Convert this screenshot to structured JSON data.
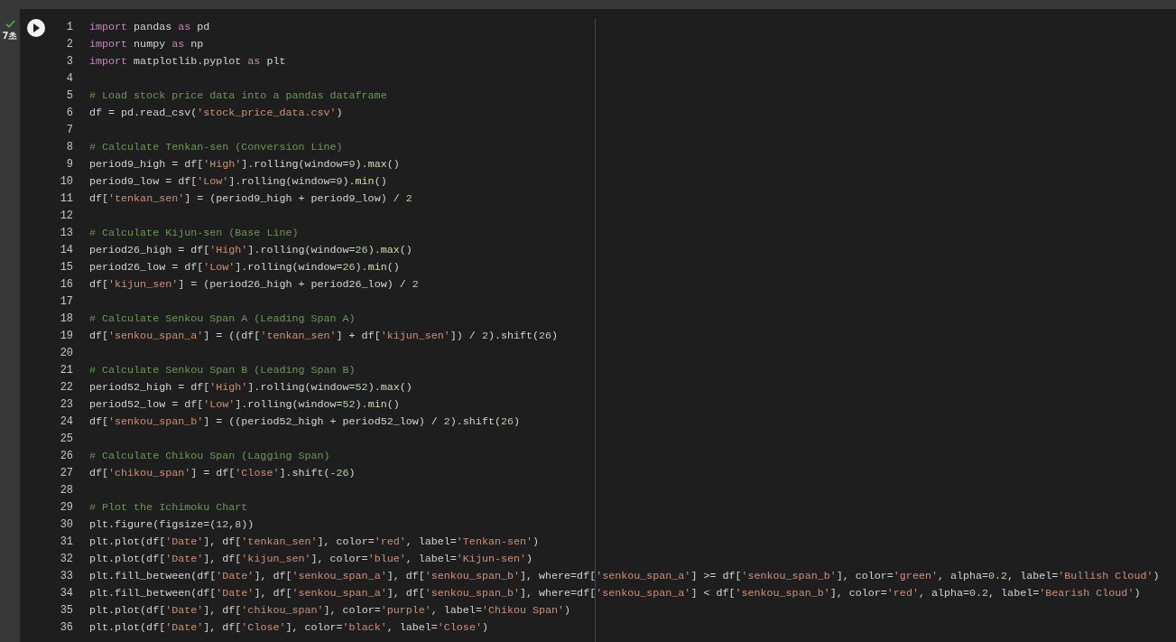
{
  "cell": {
    "status": {
      "done": true,
      "duration": "7초"
    },
    "lines": [
      {
        "number": "1",
        "tokens": [
          {
            "kind": "kw",
            "text": "import"
          },
          {
            "kind": "tx",
            "text": " pandas "
          },
          {
            "kind": "kw",
            "text": "as"
          },
          {
            "kind": "tx",
            "text": " pd"
          }
        ]
      },
      {
        "number": "2",
        "tokens": [
          {
            "kind": "kw",
            "text": "import"
          },
          {
            "kind": "tx",
            "text": " numpy "
          },
          {
            "kind": "kw",
            "text": "as"
          },
          {
            "kind": "tx",
            "text": " np"
          }
        ]
      },
      {
        "number": "3",
        "tokens": [
          {
            "kind": "kw",
            "text": "import"
          },
          {
            "kind": "tx",
            "text": " matplotlib.pyplot "
          },
          {
            "kind": "kw",
            "text": "as"
          },
          {
            "kind": "tx",
            "text": " plt"
          }
        ]
      },
      {
        "number": "4"
      },
      {
        "number": "5",
        "tokens": [
          {
            "kind": "cm",
            "text": "# Load stock price data into a pandas dataframe"
          }
        ]
      },
      {
        "number": "6",
        "tokens": [
          {
            "kind": "tx",
            "text": "df = pd.read_csv("
          },
          {
            "kind": "st",
            "text": "'stock_price_data.csv'"
          },
          {
            "kind": "tx",
            "text": ")"
          }
        ]
      },
      {
        "number": "7"
      },
      {
        "number": "8",
        "tokens": [
          {
            "kind": "cm",
            "text": "# Calculate Tenkan-sen (Conversion Line)"
          }
        ]
      },
      {
        "number": "9",
        "tokens": [
          {
            "kind": "tx",
            "text": "period9_high = df["
          },
          {
            "kind": "st",
            "text": "'High'"
          },
          {
            "kind": "tx",
            "text": "].rolling(window="
          },
          {
            "kind": "nu",
            "text": "9"
          },
          {
            "kind": "tx",
            "text": ")."
          },
          {
            "kind": "fn",
            "text": "max"
          },
          {
            "kind": "tx",
            "text": "()"
          }
        ]
      },
      {
        "number": "10",
        "tokens": [
          {
            "kind": "tx",
            "text": "period9_low = df["
          },
          {
            "kind": "st",
            "text": "'Low'"
          },
          {
            "kind": "tx",
            "text": "].rolling(window="
          },
          {
            "kind": "nu",
            "text": "9"
          },
          {
            "kind": "tx",
            "text": ")."
          },
          {
            "kind": "fn",
            "text": "min"
          },
          {
            "kind": "tx",
            "text": "()"
          }
        ]
      },
      {
        "number": "11",
        "tokens": [
          {
            "kind": "tx",
            "text": "df["
          },
          {
            "kind": "st",
            "text": "'tenkan_sen'"
          },
          {
            "kind": "tx",
            "text": "] = (period9_high + period9_low) / "
          },
          {
            "kind": "nu",
            "text": "2"
          }
        ]
      },
      {
        "number": "12"
      },
      {
        "number": "13",
        "tokens": [
          {
            "kind": "cm",
            "text": "# Calculate Kijun-sen (Base Line)"
          }
        ]
      },
      {
        "number": "14",
        "tokens": [
          {
            "kind": "tx",
            "text": "period26_high = df["
          },
          {
            "kind": "st",
            "text": "'High'"
          },
          {
            "kind": "tx",
            "text": "].rolling(window="
          },
          {
            "kind": "nu",
            "text": "26"
          },
          {
            "kind": "tx",
            "text": ")."
          },
          {
            "kind": "fn",
            "text": "max"
          },
          {
            "kind": "tx",
            "text": "()"
          }
        ]
      },
      {
        "number": "15",
        "tokens": [
          {
            "kind": "tx",
            "text": "period26_low = df["
          },
          {
            "kind": "st",
            "text": "'Low'"
          },
          {
            "kind": "tx",
            "text": "].rolling(window="
          },
          {
            "kind": "nu",
            "text": "26"
          },
          {
            "kind": "tx",
            "text": ")."
          },
          {
            "kind": "fn",
            "text": "min"
          },
          {
            "kind": "tx",
            "text": "()"
          }
        ]
      },
      {
        "number": "16",
        "tokens": [
          {
            "kind": "tx",
            "text": "df["
          },
          {
            "kind": "st",
            "text": "'kijun_sen'"
          },
          {
            "kind": "tx",
            "text": "] = (period26_high + period26_low) / "
          },
          {
            "kind": "nu",
            "text": "2"
          }
        ]
      },
      {
        "number": "17"
      },
      {
        "number": "18",
        "tokens": [
          {
            "kind": "cm",
            "text": "# Calculate Senkou Span A (Leading Span A)"
          }
        ]
      },
      {
        "number": "19",
        "tokens": [
          {
            "kind": "tx",
            "text": "df["
          },
          {
            "kind": "st",
            "text": "'senkou_span_a'"
          },
          {
            "kind": "tx",
            "text": "] = ((df["
          },
          {
            "kind": "st",
            "text": "'tenkan_sen'"
          },
          {
            "kind": "tx",
            "text": "] + df["
          },
          {
            "kind": "st",
            "text": "'kijun_sen'"
          },
          {
            "kind": "tx",
            "text": "]) / "
          },
          {
            "kind": "nu",
            "text": "2"
          },
          {
            "kind": "tx",
            "text": ").shift("
          },
          {
            "kind": "nu",
            "text": "26"
          },
          {
            "kind": "tx",
            "text": ")"
          }
        ]
      },
      {
        "number": "20"
      },
      {
        "number": "21",
        "tokens": [
          {
            "kind": "cm",
            "text": "# Calculate Senkou Span B (Leading Span B)"
          }
        ]
      },
      {
        "number": "22",
        "tokens": [
          {
            "kind": "tx",
            "text": "period52_high = df["
          },
          {
            "kind": "st",
            "text": "'High'"
          },
          {
            "kind": "tx",
            "text": "].rolling(window="
          },
          {
            "kind": "nu",
            "text": "52"
          },
          {
            "kind": "tx",
            "text": ")."
          },
          {
            "kind": "fn",
            "text": "max"
          },
          {
            "kind": "tx",
            "text": "()"
          }
        ]
      },
      {
        "number": "23",
        "tokens": [
          {
            "kind": "tx",
            "text": "period52_low = df["
          },
          {
            "kind": "st",
            "text": "'Low'"
          },
          {
            "kind": "tx",
            "text": "].rolling(window="
          },
          {
            "kind": "nu",
            "text": "52"
          },
          {
            "kind": "tx",
            "text": ")."
          },
          {
            "kind": "fn",
            "text": "min"
          },
          {
            "kind": "tx",
            "text": "()"
          }
        ]
      },
      {
        "number": "24",
        "tokens": [
          {
            "kind": "tx",
            "text": "df["
          },
          {
            "kind": "st",
            "text": "'senkou_span_b'"
          },
          {
            "kind": "tx",
            "text": "] = ((period52_high + period52_low) / "
          },
          {
            "kind": "nu",
            "text": "2"
          },
          {
            "kind": "tx",
            "text": ").shift("
          },
          {
            "kind": "nu",
            "text": "26"
          },
          {
            "kind": "tx",
            "text": ")"
          }
        ]
      },
      {
        "number": "25"
      },
      {
        "number": "26",
        "tokens": [
          {
            "kind": "cm",
            "text": "# Calculate Chikou Span (Lagging Span)"
          }
        ]
      },
      {
        "number": "27",
        "tokens": [
          {
            "kind": "tx",
            "text": "df["
          },
          {
            "kind": "st",
            "text": "'chikou_span'"
          },
          {
            "kind": "tx",
            "text": "] = df["
          },
          {
            "kind": "st",
            "text": "'Close'"
          },
          {
            "kind": "tx",
            "text": "].shift("
          },
          {
            "kind": "nu",
            "text": "-26"
          },
          {
            "kind": "tx",
            "text": ")"
          }
        ]
      },
      {
        "number": "28"
      },
      {
        "number": "29",
        "tokens": [
          {
            "kind": "cm",
            "text": "# Plot the Ichimoku Chart"
          }
        ]
      },
      {
        "number": "30",
        "tokens": [
          {
            "kind": "tx",
            "text": "plt.figure(figsize=("
          },
          {
            "kind": "nu",
            "text": "12"
          },
          {
            "kind": "tx",
            "text": ","
          },
          {
            "kind": "nu",
            "text": "8"
          },
          {
            "kind": "tx",
            "text": "))"
          }
        ]
      },
      {
        "number": "31",
        "tokens": [
          {
            "kind": "tx",
            "text": "plt.plot(df["
          },
          {
            "kind": "st",
            "text": "'Date'"
          },
          {
            "kind": "tx",
            "text": "], df["
          },
          {
            "kind": "st",
            "text": "'tenkan_sen'"
          },
          {
            "kind": "tx",
            "text": "], color="
          },
          {
            "kind": "st",
            "text": "'red'"
          },
          {
            "kind": "tx",
            "text": ", label="
          },
          {
            "kind": "st",
            "text": "'Tenkan-sen'"
          },
          {
            "kind": "tx",
            "text": ")"
          }
        ]
      },
      {
        "number": "32",
        "tokens": [
          {
            "kind": "tx",
            "text": "plt.plot(df["
          },
          {
            "kind": "st",
            "text": "'Date'"
          },
          {
            "kind": "tx",
            "text": "], df["
          },
          {
            "kind": "st",
            "text": "'kijun_sen'"
          },
          {
            "kind": "tx",
            "text": "], color="
          },
          {
            "kind": "st",
            "text": "'blue'"
          },
          {
            "kind": "tx",
            "text": ", label="
          },
          {
            "kind": "st",
            "text": "'Kijun-sen'"
          },
          {
            "kind": "tx",
            "text": ")"
          }
        ]
      },
      {
        "number": "33",
        "tokens": [
          {
            "kind": "tx",
            "text": "plt.fill_between(df["
          },
          {
            "kind": "st",
            "text": "'Date'"
          },
          {
            "kind": "tx",
            "text": "], df["
          },
          {
            "kind": "st",
            "text": "'senkou_span_a'"
          },
          {
            "kind": "tx",
            "text": "], df["
          },
          {
            "kind": "st",
            "text": "'senkou_span_b'"
          },
          {
            "kind": "tx",
            "text": "], where=df["
          },
          {
            "kind": "st",
            "text": "'senkou_span_a'"
          },
          {
            "kind": "tx",
            "text": "] >= df["
          },
          {
            "kind": "st",
            "text": "'senkou_span_b'"
          },
          {
            "kind": "tx",
            "text": "], color="
          },
          {
            "kind": "st",
            "text": "'green'"
          },
          {
            "kind": "tx",
            "text": ", alpha="
          },
          {
            "kind": "nu",
            "text": "0.2"
          },
          {
            "kind": "tx",
            "text": ", label="
          },
          {
            "kind": "st",
            "text": "'Bullish Cloud'"
          },
          {
            "kind": "tx",
            "text": ")"
          }
        ]
      },
      {
        "number": "34",
        "tokens": [
          {
            "kind": "tx",
            "text": "plt.fill_between(df["
          },
          {
            "kind": "st",
            "text": "'Date'"
          },
          {
            "kind": "tx",
            "text": "], df["
          },
          {
            "kind": "st",
            "text": "'senkou_span_a'"
          },
          {
            "kind": "tx",
            "text": "], df["
          },
          {
            "kind": "st",
            "text": "'senkou_span_b'"
          },
          {
            "kind": "tx",
            "text": "], where=df["
          },
          {
            "kind": "st",
            "text": "'senkou_span_a'"
          },
          {
            "kind": "tx",
            "text": "] < df["
          },
          {
            "kind": "st",
            "text": "'senkou_span_b'"
          },
          {
            "kind": "tx",
            "text": "], color="
          },
          {
            "kind": "st",
            "text": "'red'"
          },
          {
            "kind": "tx",
            "text": ", alpha="
          },
          {
            "kind": "nu",
            "text": "0.2"
          },
          {
            "kind": "tx",
            "text": ", label="
          },
          {
            "kind": "st",
            "text": "'Bearish Cloud'"
          },
          {
            "kind": "tx",
            "text": ")"
          }
        ]
      },
      {
        "number": "35",
        "tokens": [
          {
            "kind": "tx",
            "text": "plt.plot(df["
          },
          {
            "kind": "st",
            "text": "'Date'"
          },
          {
            "kind": "tx",
            "text": "], df["
          },
          {
            "kind": "st",
            "text": "'chikou_span'"
          },
          {
            "kind": "tx",
            "text": "], color="
          },
          {
            "kind": "st",
            "text": "'purple'"
          },
          {
            "kind": "tx",
            "text": ", label="
          },
          {
            "kind": "st",
            "text": "'Chikou Span'"
          },
          {
            "kind": "tx",
            "text": ")"
          }
        ]
      },
      {
        "number": "36",
        "tokens": [
          {
            "kind": "tx",
            "text": "plt.plot(df["
          },
          {
            "kind": "st",
            "text": "'Date'"
          },
          {
            "kind": "tx",
            "text": "], df["
          },
          {
            "kind": "st",
            "text": "'Close'"
          },
          {
            "kind": "tx",
            "text": "], color="
          },
          {
            "kind": "st",
            "text": "'black'"
          },
          {
            "kind": "tx",
            "text": ", label="
          },
          {
            "kind": "st",
            "text": "'Close'"
          },
          {
            "kind": "tx",
            "text": ")"
          }
        ]
      }
    ]
  }
}
